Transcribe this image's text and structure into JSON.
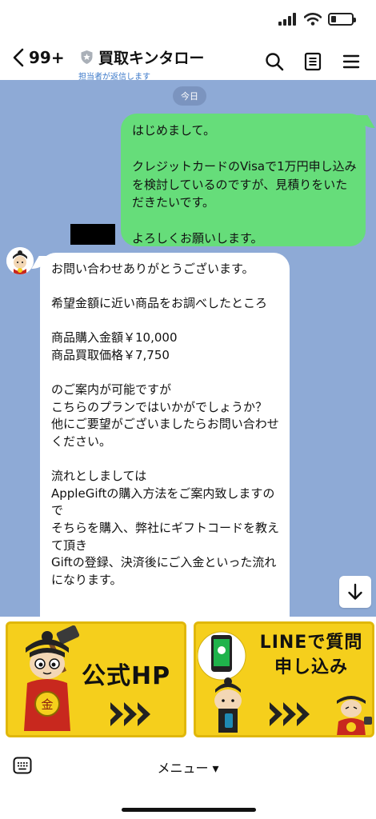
{
  "status_bar": {
    "icons": [
      "signal-icon",
      "wifi-icon",
      "battery-icon"
    ],
    "battery_level": 0.2
  },
  "header": {
    "back_count": "99+",
    "title": "買取キンタロー",
    "subtitle": "担当者が返信します",
    "icons": [
      "search-icon",
      "note-icon",
      "menu-icon"
    ],
    "subtitle_color": "#3b78c9"
  },
  "chat": {
    "background_color": "#8eaad6",
    "date_label": "今日",
    "outgoing_message": "はじめまして。\n\nクレジットカードのVisaで1万円申し込みを検討しているのですが、見積りをいただきたいです。\n\nよろしくお願いします。",
    "outgoing_color": "#66dd7a",
    "incoming_message": "お問い合わせありがとうございます。\n\n希望金額に近い商品をお調べしたところ\n\n商品購入金額￥10,000\n商品買取価格￥7,750\n\nのご案内が可能ですが\nこちらのプランではいかがでしょうか？\n他にご要望がございましたらお問い合わせください。\n\n流れとしましては\nAppleGiftの購入方法をご案内致しますので\nそちらを購入、弊社にギフトコードを教えて頂き\nGiftの登録、決済後にご入金といった流れになります。"
  },
  "rich_menu": {
    "left_label": "公式HP",
    "right_label": "LINEで質問\n申し込み",
    "button_color": "#f5cf1c",
    "coin_label": "金"
  },
  "bottom_bar": {
    "menu_label": "メニュー ▾"
  }
}
